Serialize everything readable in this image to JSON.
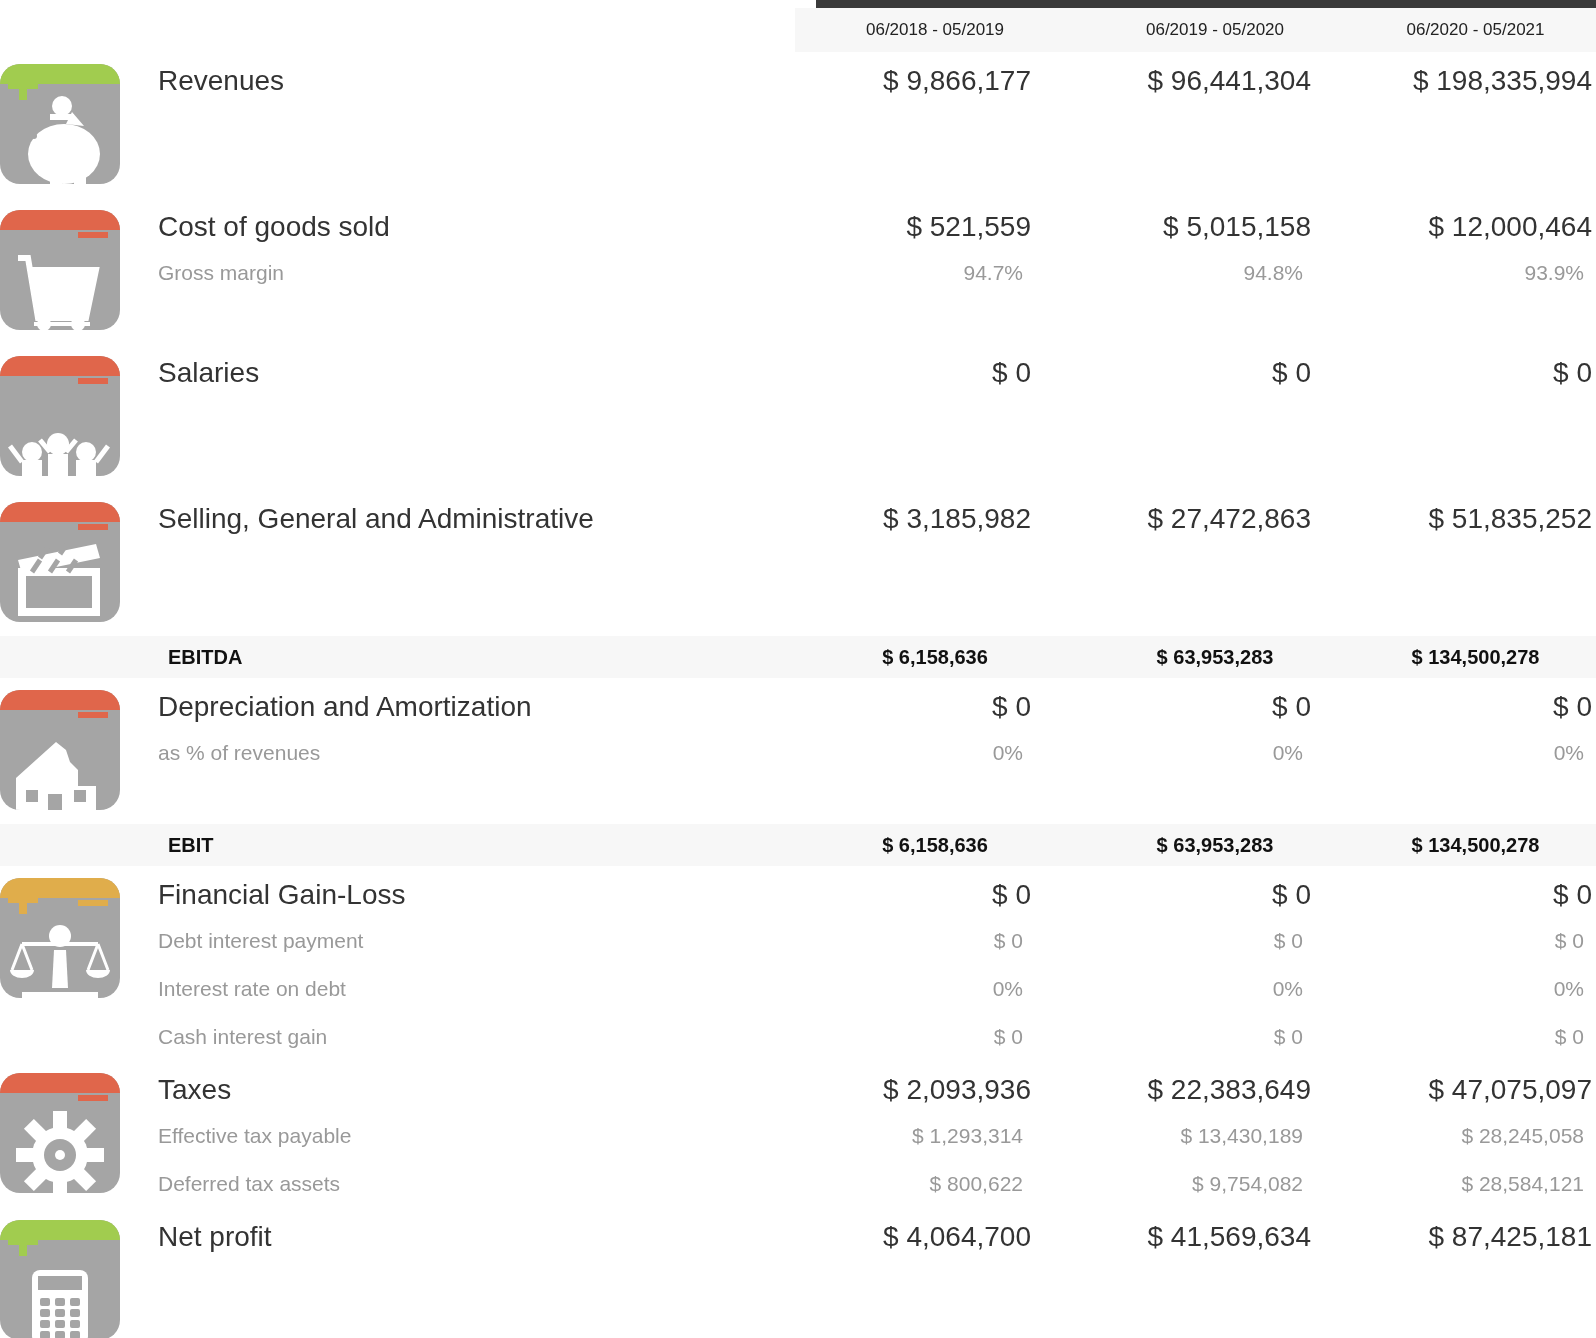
{
  "columns": [
    "06/2018 - 05/2019",
    "06/2019 - 05/2020",
    "06/2020 - 05/2021"
  ],
  "rows": [
    {
      "kind": "item",
      "label": "Revenues",
      "color": "#a1cc4f",
      "values": [
        "$ 9,866,177",
        "$ 96,441,304",
        "$ 198,335,994"
      ],
      "details": []
    },
    {
      "kind": "item",
      "label": "Cost of goods sold",
      "color": "#e0664b",
      "values": [
        "$ 521,559",
        "$ 5,015,158",
        "$ 12,000,464"
      ],
      "details": [
        {
          "label": "Gross margin",
          "values": [
            "94.7%",
            "94.8%",
            "93.9%"
          ]
        }
      ]
    },
    {
      "kind": "item",
      "label": "Salaries",
      "color": "#e0664b",
      "values": [
        "$ 0",
        "$ 0",
        "$ 0"
      ],
      "details": []
    },
    {
      "kind": "item",
      "label": "Selling, General and Administrative",
      "color": "#e0664b",
      "values": [
        "$ 3,185,982",
        "$ 27,472,863",
        "$ 51,835,252"
      ],
      "details": []
    },
    {
      "kind": "total",
      "label": "EBITDA",
      "values": [
        "$ 6,158,636",
        "$ 63,953,283",
        "$ 134,500,278"
      ]
    },
    {
      "kind": "item",
      "label": "Depreciation and Amortization",
      "color": "#e0664b",
      "values": [
        "$ 0",
        "$ 0",
        "$ 0"
      ],
      "details": [
        {
          "label": "as % of revenues",
          "values": [
            "0%",
            "0%",
            "0%"
          ]
        }
      ]
    },
    {
      "kind": "total",
      "label": "EBIT",
      "values": [
        "$ 6,158,636",
        "$ 63,953,283",
        "$ 134,500,278"
      ]
    },
    {
      "kind": "item",
      "label": "Financial Gain-Loss",
      "color": "#e0ad4b",
      "values": [
        "$ 0",
        "$ 0",
        "$ 0"
      ],
      "details": [
        {
          "label": "Debt interest payment",
          "values": [
            "$ 0",
            "$ 0",
            "$ 0"
          ]
        },
        {
          "label": "Interest rate on debt",
          "values": [
            "0%",
            "0%",
            "0%"
          ]
        },
        {
          "label": "Cash interest gain",
          "values": [
            "$ 0",
            "$ 0",
            "$ 0"
          ]
        }
      ]
    },
    {
      "kind": "item",
      "label": "Taxes",
      "color": "#e0664b",
      "values": [
        "$ 2,093,936",
        "$ 22,383,649",
        "$ 47,075,097"
      ],
      "details": [
        {
          "label": "Effective tax payable",
          "values": [
            "$ 1,293,314",
            "$ 13,430,189",
            "$ 28,245,058"
          ]
        },
        {
          "label": "Deferred tax assets",
          "values": [
            "$ 800,622",
            "$ 9,754,082",
            "$ 28,584,121"
          ]
        }
      ]
    },
    {
      "kind": "item",
      "label": "Net profit",
      "color": "#a1cc4f",
      "values": [
        "$ 4,064,700",
        "$ 41,569,634",
        "$ 87,425,181"
      ],
      "details": []
    }
  ]
}
